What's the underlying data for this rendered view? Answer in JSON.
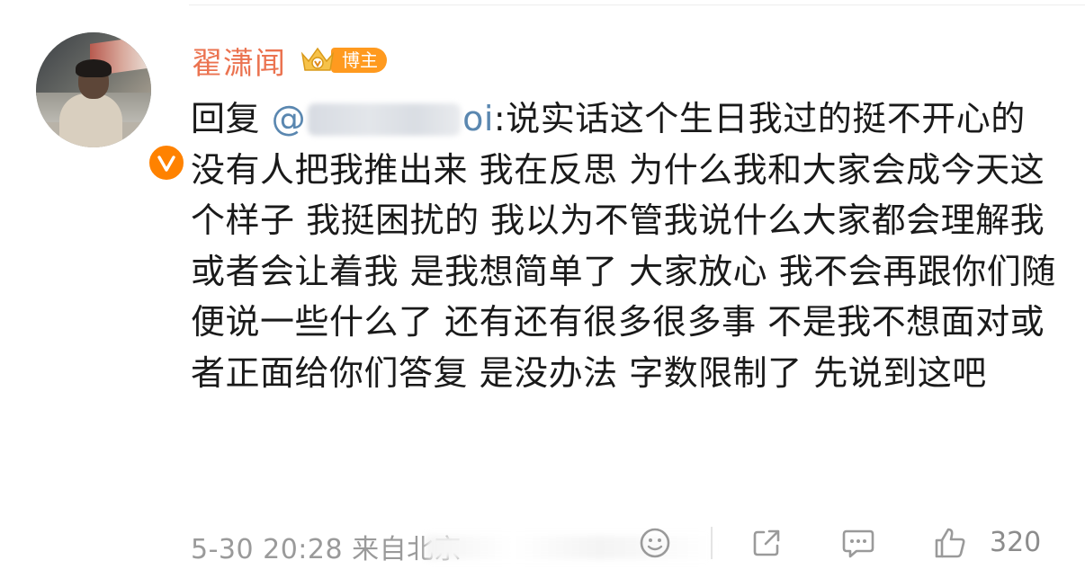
{
  "post": {
    "username": "翟潇闻",
    "badge_label": "博主",
    "reply_prefix": "回复",
    "mention_at": "@",
    "mention_suffix": "oi",
    "content_text": ":说实话这个生日我过的挺不开心的 没有人把我推出来 我在反思 为什么我和大家会成今天这个样子 我挺困扰的 我以为不管我说什么大家都会理解我或者会让着我 是我想简单了 大家放心 我不会再跟你们随便说一些什么了 还有还有很多很多事 不是我不想面对或者正面给你们答复 是没办法 字数限制了 先说到这吧",
    "timestamp": "5-30 20:28",
    "source": "来自北京",
    "like_count": "320"
  },
  "icons": {
    "avatar": "avatar-photo",
    "verified": "verified-v-icon",
    "vip": "crown-icon",
    "emoji": "emoji-icon",
    "share": "share-icon",
    "comment": "comment-icon",
    "like": "thumbs-up-icon"
  },
  "colors": {
    "username": "#eb7350",
    "mention": "#5a87b0",
    "badge": "#ff9a1f",
    "verified": "#ff8200",
    "meta": "#9a9a9a"
  }
}
